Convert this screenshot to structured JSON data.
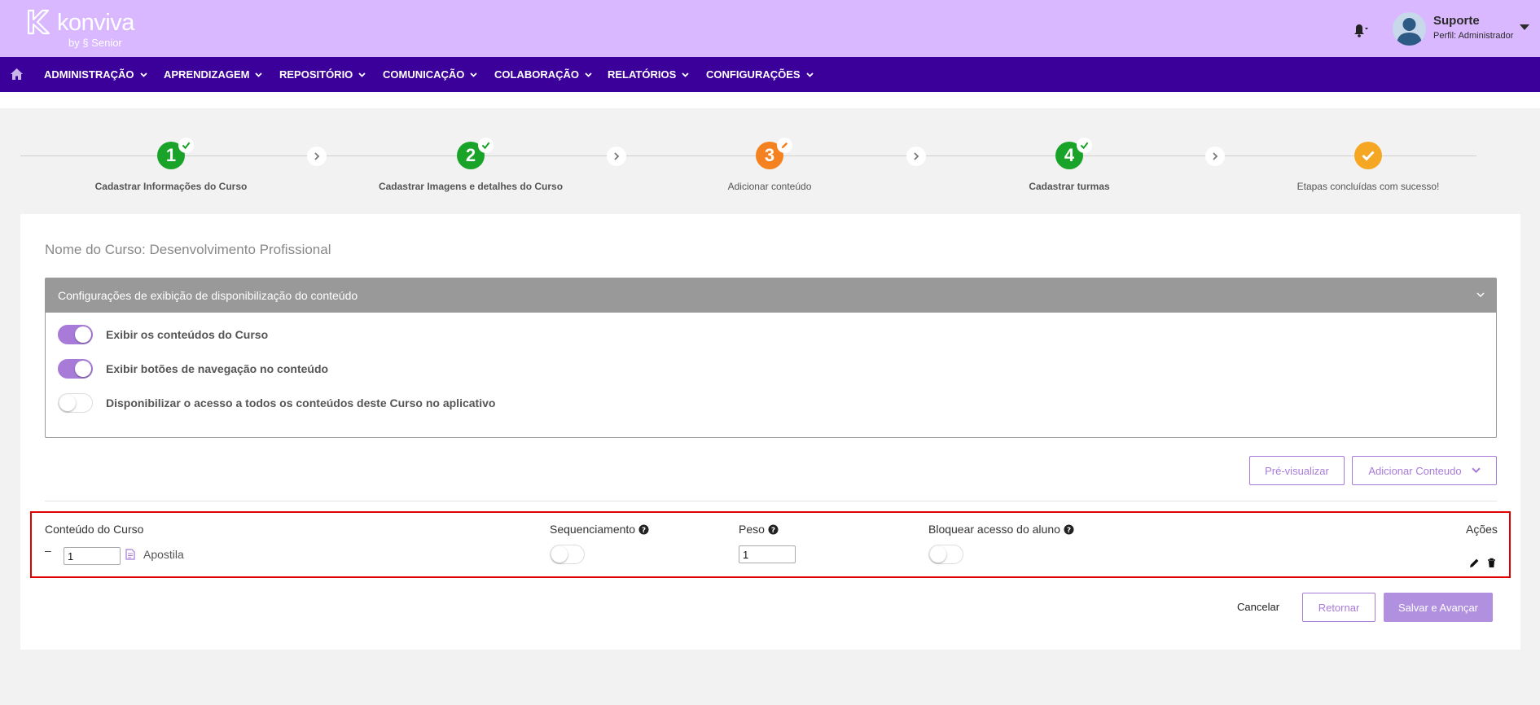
{
  "brand": {
    "name": "konviva",
    "byline": "by § Senior"
  },
  "user": {
    "name": "Suporte",
    "role": "Perfil: Administrador"
  },
  "nav": {
    "items": [
      {
        "label": "ADMINISTRAÇÃO"
      },
      {
        "label": "APRENDIZAGEM"
      },
      {
        "label": "REPOSITÓRIO"
      },
      {
        "label": "COMUNICAÇÃO"
      },
      {
        "label": "COLABORAÇÃO"
      },
      {
        "label": "RELATÓRIOS"
      },
      {
        "label": "CONFIGURAÇÕES"
      }
    ]
  },
  "stepper": {
    "steps": [
      {
        "number": "1",
        "label": "Cadastrar Informações do Curso",
        "status": "done",
        "color": "#1aa329"
      },
      {
        "number": "2",
        "label": "Cadastrar Imagens e detalhes do Curso",
        "status": "done",
        "color": "#1aa329"
      },
      {
        "number": "3",
        "label": "Adicionar conteúdo",
        "status": "editing",
        "color": "#f58220"
      },
      {
        "number": "4",
        "label": "Cadastrar turmas",
        "status": "done",
        "color": "#1aa329"
      },
      {
        "number": "",
        "label": "Etapas concluídas com sucesso!",
        "status": "final",
        "color": "#f5a623"
      }
    ]
  },
  "main": {
    "course_name": "Nome do Curso: Desenvolvimento Profissional",
    "config": {
      "title": "Configurações de exibição de disponibilização do conteúdo",
      "toggles": [
        {
          "label": "Exibir os conteúdos do Curso",
          "on": true
        },
        {
          "label": "Exibir botões de navegação no conteúdo",
          "on": true
        },
        {
          "label": "Disponibilizar o acesso a todos os conteúdos deste Curso no aplicativo",
          "on": false
        }
      ]
    },
    "preview_button": "Pré-visualizar",
    "add_content_button": "Adicionar Conteudo",
    "table": {
      "headers": {
        "content": "Conteúdo do Curso",
        "sequencing": "Sequenciamento",
        "weight": "Peso",
        "block": "Bloquear acesso do aluno",
        "actions": "Ações"
      },
      "rows": [
        {
          "minus": "–",
          "order": "1",
          "title": "Apostila",
          "sequencing": false,
          "weight": "1",
          "block": false
        }
      ]
    },
    "footer": {
      "cancel": "Cancelar",
      "back": "Retornar",
      "save": "Salvar e Avançar"
    }
  },
  "colors": {
    "header_bg": "#d9b8ff",
    "nav_bg": "#3b0099",
    "accent": "#a87bd9",
    "highlight_border": "#e00000"
  }
}
